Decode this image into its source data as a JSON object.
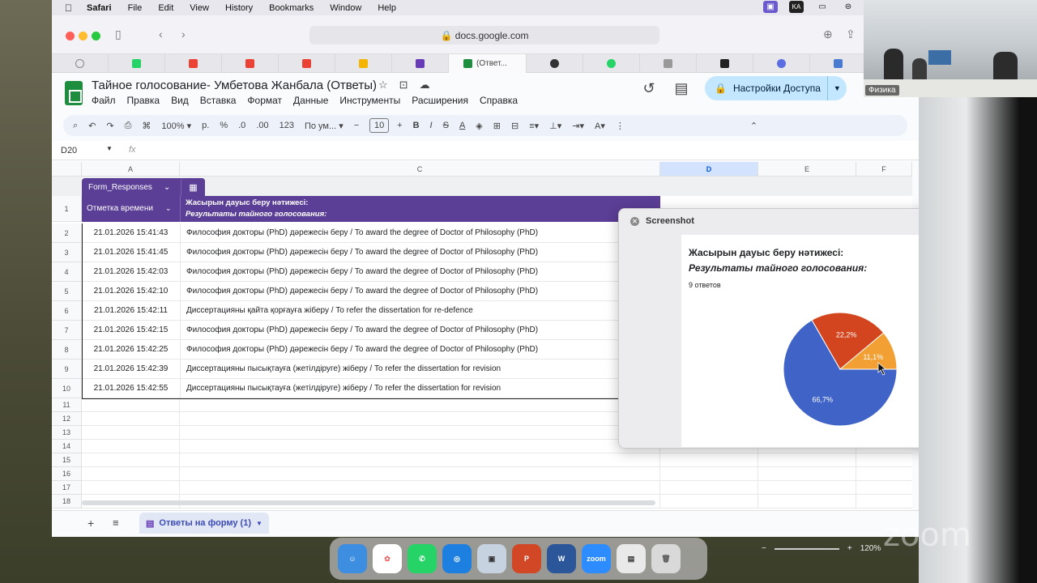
{
  "menubar": {
    "app": "Safari",
    "items": [
      "File",
      "Edit",
      "View",
      "History",
      "Bookmarks",
      "Window",
      "Help"
    ],
    "kbd": "KA"
  },
  "browser": {
    "url": "docs.google.com",
    "active_tab": "(Ответ..."
  },
  "doc": {
    "title": "Тайное голосование- Умбетова Жанбала (Ответы)",
    "menus": [
      "Файл",
      "Правка",
      "Вид",
      "Вставка",
      "Формат",
      "Данные",
      "Инструменты",
      "Расширения",
      "Справка"
    ],
    "share_label": "Настройки Доступа"
  },
  "format": {
    "zoom": "100%",
    "currency": "р.",
    "percent": "%",
    "dec_dec": ".0",
    "dec_inc": ".00",
    "num": "123",
    "font": "По ум...",
    "font_size": "10"
  },
  "namebox": {
    "ref": "D20",
    "fx": "fx"
  },
  "columns": {
    "a": "A",
    "c": "C",
    "d": "D",
    "e": "E",
    "f": "F"
  },
  "table": {
    "name": "Form_Responses",
    "col1_header": "Отметка времени",
    "col2_header_line1": "Жасырын дауыс беру нәтижесі:",
    "col2_header_line2": "Результаты тайного голосования:"
  },
  "rows": [
    {
      "n": "1"
    },
    {
      "n": "2",
      "ts": "21.01.2026 15:41:43",
      "val": "Философия докторы (PhD) дәрежесін беру / To award the degree of Doctor of Philosophy (PhD)"
    },
    {
      "n": "3",
      "ts": "21.01.2026 15:41:45",
      "val": "Философия докторы (PhD) дәрежесін беру / To award the degree of Doctor of Philosophy (PhD)"
    },
    {
      "n": "4",
      "ts": "21.01.2026 15:42:03",
      "val": "Философия докторы (PhD) дәрежесін беру / To award the degree of Doctor of Philosophy (PhD)"
    },
    {
      "n": "5",
      "ts": "21.01.2026 15:42:10",
      "val": "Философия докторы (PhD) дәрежесін беру / To award the degree of Doctor of Philosophy (PhD)"
    },
    {
      "n": "6",
      "ts": "21.01.2026 15:42:11",
      "val": "Диссертацияны қайта қорғауға жіберу / To refer the dissertation for re-defence"
    },
    {
      "n": "7",
      "ts": "21.01.2026 15:42:15",
      "val": "Философия докторы (PhD) дәрежесін беру / To award the degree of Doctor of Philosophy (PhD)"
    },
    {
      "n": "8",
      "ts": "21.01.2026 15:42:25",
      "val": "Философия докторы (PhD) дәрежесін беру / To award the degree of Doctor of Philosophy (PhD)"
    },
    {
      "n": "9",
      "ts": "21.01.2026 15:42:39",
      "val": "Диссертацияны пысықтауға (жетілдіруге) жіберу / To refer the dissertation for revision"
    },
    {
      "n": "10",
      "ts": "21.01.2026 15:42:55",
      "val": "Диссертацияны пысықтауға (жетілдіруге) жіберу / To refer the dissertation for revision"
    },
    {
      "n": "11"
    },
    {
      "n": "12"
    },
    {
      "n": "13"
    },
    {
      "n": "14"
    },
    {
      "n": "15"
    },
    {
      "n": "16"
    },
    {
      "n": "17"
    },
    {
      "n": "18"
    }
  ],
  "sheet_tab": "Ответы на форму (1)",
  "popup": {
    "title": "Screenshot",
    "chart_title1": "Жасырын дауыс беру нәтижесі:",
    "chart_title2": "Результаты тайного голосования:",
    "count": "9 ответов"
  },
  "chart_data": {
    "type": "pie",
    "slices": [
      {
        "value": 66.7,
        "label": "66,7%",
        "color": "#3f63c7"
      },
      {
        "value": 22.2,
        "label": "22,2%",
        "color": "#d2451e"
      },
      {
        "value": 11.1,
        "label": "11,1%",
        "color": "#f2a033"
      }
    ],
    "legend_colors": [
      "#3f63c7",
      "#d2451e",
      "#f2a033",
      "#3a9a3a"
    ]
  },
  "webcam": {
    "name": "Физика"
  },
  "zoom": {
    "watermark": "zoom",
    "level": "120%"
  }
}
